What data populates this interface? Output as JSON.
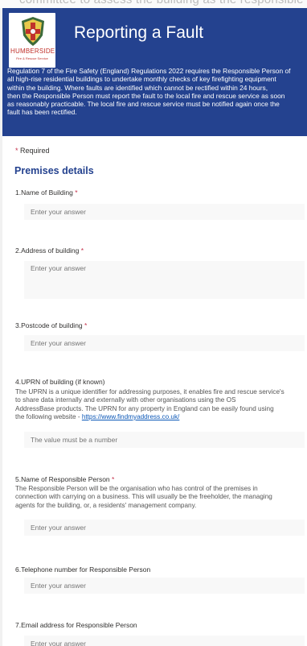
{
  "top_strip_text": "committee to assess the building as the responsible",
  "header": {
    "logo": {
      "text": "HUMBERSIDE",
      "subtext": "Fire & Rescue Service",
      "icon": "crest-icon"
    },
    "title": "Reporting a Fault",
    "intro_lines": [
      "Regulation 7 of the Fire Safety (England) Regulations 2022 requires the Responsible Person of",
      "all high-rise residential buildings to undertake monthly checks of key firefighting equipment",
      "within the building.  Where faults are identified which cannot be rectified within 24 hours,",
      "then the Responsible Person must report the fault to the local fire and rescue service as soon",
      "as reasonably practicable.  The local fire and rescue service must be notified again once the",
      "fault has been rectified."
    ]
  },
  "form": {
    "required_note": "Required",
    "section_title": "Premises details",
    "questions": [
      {
        "number": "1.",
        "label": "Name of Building",
        "required": true,
        "placeholder": "Enter your answer"
      },
      {
        "number": "2.",
        "label": "Address of building",
        "required": true,
        "placeholder": "Enter your answer"
      },
      {
        "number": "3.",
        "label": "Postcode of building",
        "required": true,
        "placeholder": "Enter your answer"
      },
      {
        "number": "4.",
        "label": "UPRN of building (if known)",
        "required": false,
        "description_lines": [
          "The UPRN is a unique identifier for addressing purposes, it enables fire and rescue service's",
          "to share data internally and externally with other organisations using the OS",
          "AddressBase products.  The UPRN for any property in England can be easily found using",
          "the following website - "
        ],
        "link_text": "https://www.findmyaddress.co.uk/",
        "placeholder": "The value must be a number"
      },
      {
        "number": "5.",
        "label": "Name of Responsible Person",
        "required": true,
        "description_lines": [
          "The Responsible Person will be the organisation who has control of the premises in",
          "connection with carrying on a business. This will usually be the freeholder, the managing",
          "agents for the building, or, a residents' management company."
        ],
        "placeholder": "Enter your answer"
      },
      {
        "number": "6.",
        "label": "Telephone number for Responsible Person",
        "required": false,
        "placeholder": "Enter your answer"
      },
      {
        "number": "7.",
        "label": "Email address for Responsible Person",
        "required": false,
        "placeholder": "Enter your answer"
      }
    ]
  },
  "colors": {
    "header_bg": "#24428f",
    "required_star": "#c4314b",
    "section_title": "#24428f",
    "link": "#0b57b7"
  }
}
